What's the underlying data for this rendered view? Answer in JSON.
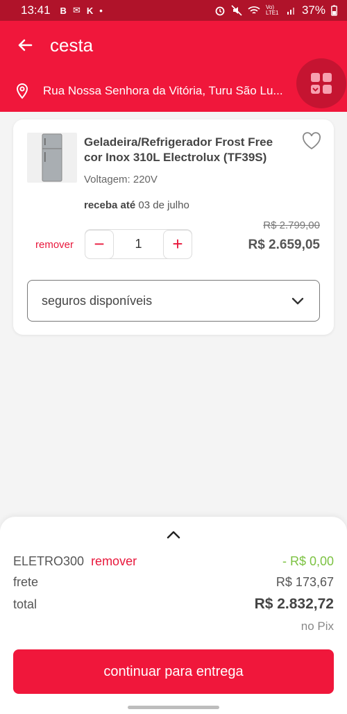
{
  "status_bar": {
    "time": "13:41",
    "left_icons": [
      "B",
      "✉",
      "K",
      "•"
    ],
    "right_icons": [
      "alarm-icon",
      "mute-icon",
      "wifi-icon",
      "VoLTE",
      "signal-icon"
    ],
    "lte_label": "Vo) LTE1",
    "battery": "37%"
  },
  "header": {
    "title": "cesta"
  },
  "address": {
    "text": "Rua Nossa Senhora da Vitória, Turu São Lu..."
  },
  "product": {
    "name": "Geladeira/Refrigerador Frost Free cor Inox 310L Electrolux (TF39S)",
    "voltage": "Voltagem: 220V",
    "delivery_label": "receba até",
    "delivery_date": "03 de julho",
    "remove_label": "remover",
    "quantity": "1",
    "minus": "−",
    "plus": "+",
    "old_price": "R$ 2.799,00",
    "price": "R$ 2.659,05",
    "insurance_label": "seguros disponíveis"
  },
  "summary": {
    "coupon_code": "ELETRO300",
    "coupon_remove": "remover",
    "coupon_discount": "- R$ 0,00",
    "shipping_label": "frete",
    "shipping_value": "R$ 173,67",
    "total_label": "total",
    "total_value": "R$ 2.832,72",
    "payment_note": "no Pix",
    "cta_label": "continuar para entrega"
  },
  "colors": {
    "brand_red": "#f0173b",
    "status_bar": "#b0132a",
    "discount_green": "#7cc242"
  }
}
